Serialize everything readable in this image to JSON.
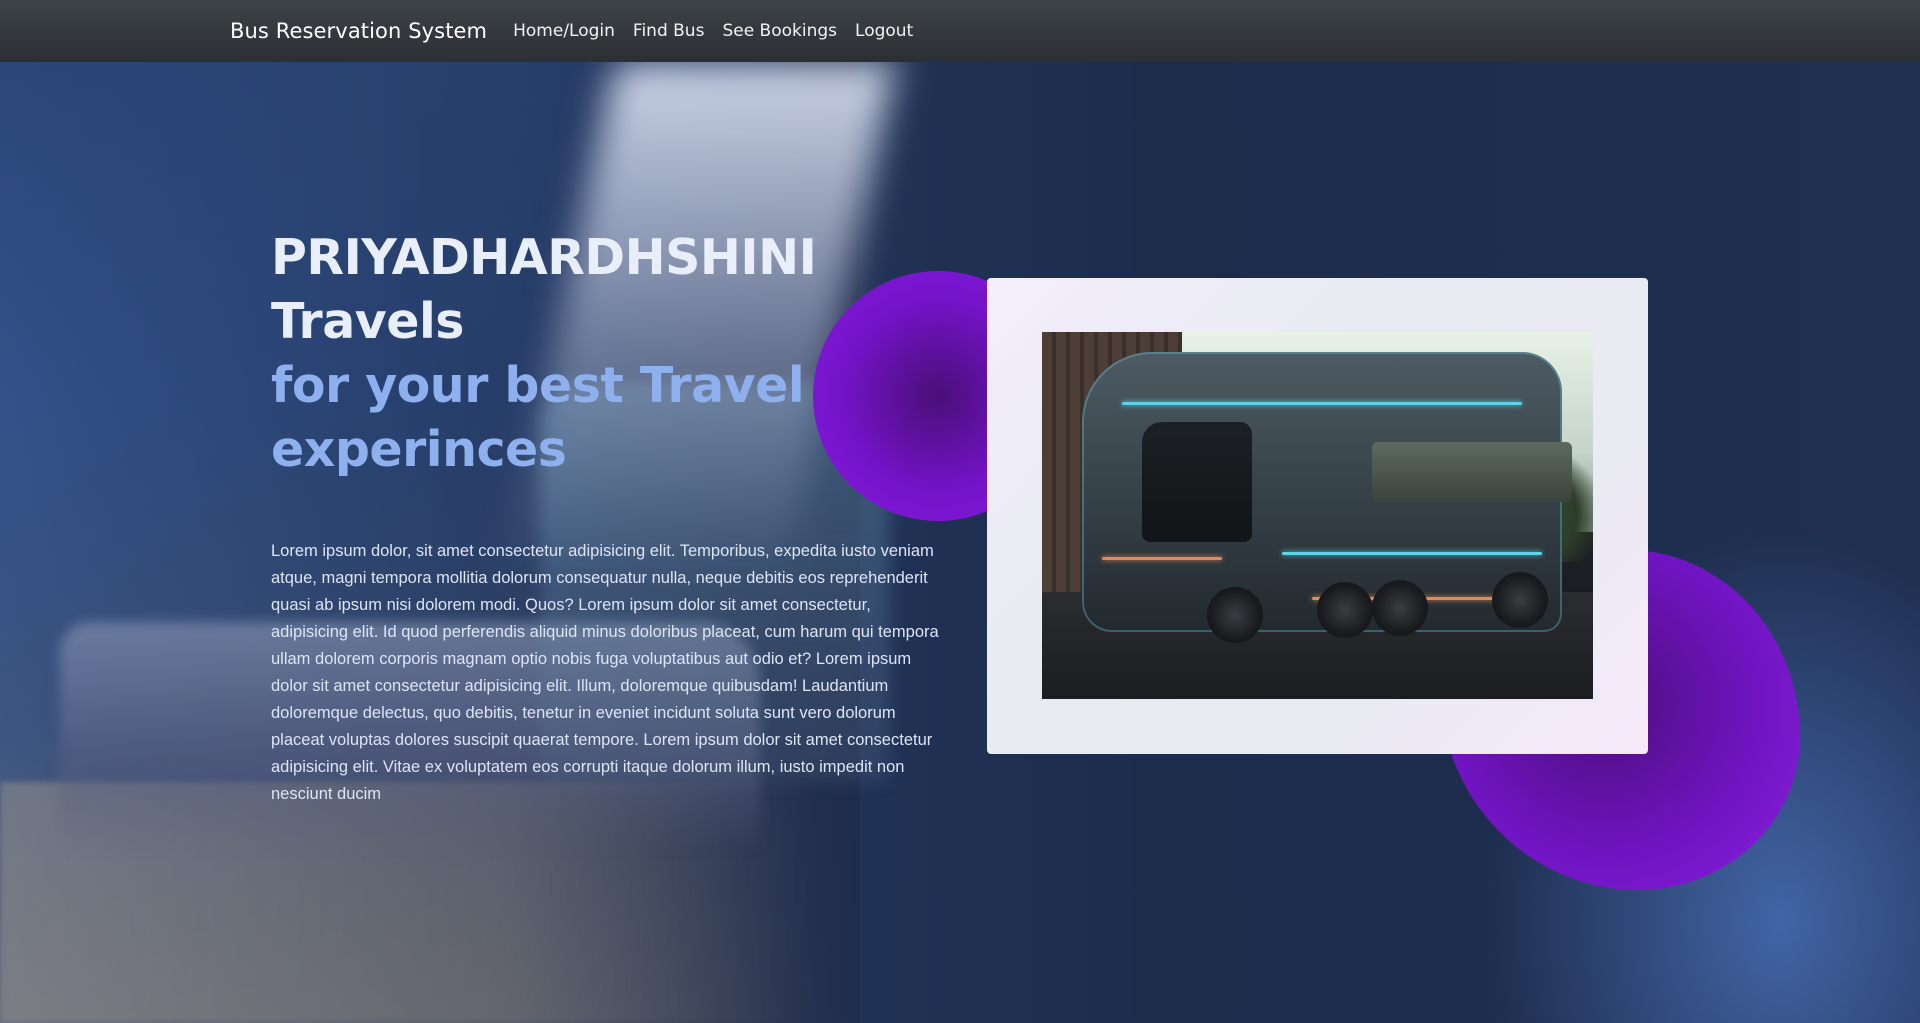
{
  "navbar": {
    "brand": "Bus Reservation System",
    "links": [
      "Home/Login",
      "Find Bus",
      "See Bookings",
      "Logout"
    ]
  },
  "hero": {
    "title_line1": "PRIYADHARDHSHINI",
    "title_line2": "Travels",
    "tagline_line1": "for your best Travel",
    "tagline_line2": "experinces",
    "paragraph": "Lorem ipsum dolor, sit amet consectetur adipisicing elit. Temporibus, expedita iusto veniam atque, magni tempora mollitia dolorum consequatur nulla, neque debitis eos reprehenderit quasi ab ipsum nisi dolorem modi. Quos? Lorem ipsum dolor sit amet consectetur, adipisicing elit. Id quod perferendis aliquid minus doloribus placeat, cum harum qui tempora ullam dolorem corporis magnam optio nobis fuga voluptatibus aut odio et? Lorem ipsum dolor sit amet consectetur adipisicing elit. Illum, doloremque quibusdam! Laudantium doloremque delectus, quo debitis, tenetur in eveniet incidunt soluta sunt vero dolorum placeat voluptas dolores suscipit quaerat tempore. Lorem ipsum dolor sit amet consectetur adipisicing elit. Vitae ex voluptatem eos corrupti itaque dolorum illum, iusto impedit non nesciunt ducim"
  },
  "colors": {
    "navbar": "#343a40",
    "headline": "#e9eefb",
    "tagline": "#8fb0ee",
    "blob": "#7413c9",
    "card": "#e8ebf1"
  }
}
